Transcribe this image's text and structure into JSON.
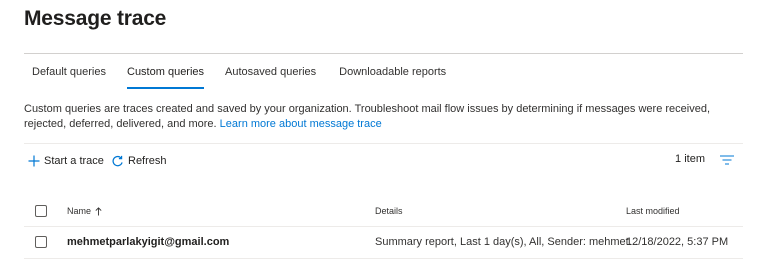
{
  "page": {
    "title": "Message trace"
  },
  "tabs": [
    {
      "label": "Default queries",
      "active": false
    },
    {
      "label": "Custom queries",
      "active": true
    },
    {
      "label": "Autosaved queries",
      "active": false
    },
    {
      "label": "Downloadable reports",
      "active": false
    }
  ],
  "description": {
    "text": "Custom queries are traces created and saved by your organization. Troubleshoot mail flow issues by determining if messages were received, rejected, deferred, delivered, and more. ",
    "link": "Learn more about message trace"
  },
  "toolbar": {
    "start_trace": "Start a trace",
    "refresh": "Refresh",
    "item_count": "1 item",
    "icons": {
      "start_trace": "plus-icon",
      "refresh": "refresh-icon",
      "filter": "filter-icon"
    }
  },
  "table": {
    "columns": {
      "name": "Name",
      "details": "Details",
      "modified": "Last modified"
    },
    "sort": {
      "column": "name",
      "direction": "ascending",
      "icon": "arrow-up-icon"
    },
    "rows": [
      {
        "name": "mehmetparlakyigit@gmail.com",
        "details": "Summary report, Last 1 day(s), All, Sender: mehmet...",
        "modified": "12/18/2022, 5:37 PM"
      }
    ]
  },
  "colors": {
    "accent": "#0078d4",
    "text": "#323130",
    "divider": "#edebe9"
  }
}
